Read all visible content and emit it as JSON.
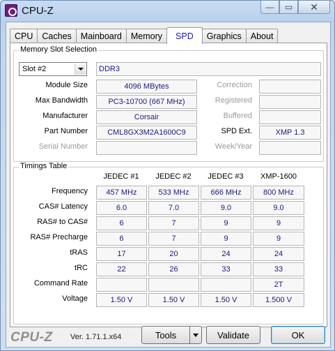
{
  "window": {
    "title": "CPU-Z",
    "caption_buttons": {
      "minimize": "—",
      "maximize": "▭",
      "close": "✕"
    }
  },
  "tabs": [
    "CPU",
    "Caches",
    "Mainboard",
    "Memory",
    "SPD",
    "Graphics",
    "About"
  ],
  "active_tab": "SPD",
  "memory_slot_selection": {
    "title": "Memory Slot Selection",
    "slot": "Slot #2",
    "type": "DDR3",
    "module_size_label": "Module Size",
    "module_size": "4096 MBytes",
    "max_bandwidth_label": "Max Bandwidth",
    "max_bandwidth": "PC3-10700 (667 MHz)",
    "manufacturer_label": "Manufacturer",
    "manufacturer": "Corsair",
    "part_number_label": "Part Number",
    "part_number": "CML8GX3M2A1600C9",
    "serial_number_label": "Serial Number",
    "serial_number": "",
    "correction_label": "Correction",
    "correction": "",
    "registered_label": "Registered",
    "registered": "",
    "buffered_label": "Buffered",
    "buffered": "",
    "spd_ext_label": "SPD Ext.",
    "spd_ext": "XMP 1.3",
    "week_year_label": "Week/Year",
    "week_year": ""
  },
  "timings_table": {
    "title": "Timings Table",
    "columns": [
      "JEDEC #1",
      "JEDEC #2",
      "JEDEC #3",
      "XMP-1600"
    ],
    "rows": [
      {
        "label": "Frequency",
        "values": [
          "457 MHz",
          "533 MHz",
          "666 MHz",
          "800 MHz"
        ]
      },
      {
        "label": "CAS# Latency",
        "values": [
          "6.0",
          "7.0",
          "9.0",
          "9.0"
        ]
      },
      {
        "label": "RAS# to CAS#",
        "values": [
          "6",
          "7",
          "9",
          "9"
        ]
      },
      {
        "label": "RAS# Precharge",
        "values": [
          "6",
          "7",
          "9",
          "9"
        ]
      },
      {
        "label": "tRAS",
        "values": [
          "17",
          "20",
          "24",
          "24"
        ]
      },
      {
        "label": "tRC",
        "values": [
          "22",
          "26",
          "33",
          "33"
        ]
      },
      {
        "label": "Command Rate",
        "values": [
          "",
          "",
          "",
          "2T"
        ]
      },
      {
        "label": "Voltage",
        "values": [
          "1.50 V",
          "1.50 V",
          "1.50 V",
          "1.500 V"
        ]
      }
    ]
  },
  "footer": {
    "logo": "CPU-Z",
    "version": "Ver. 1.71.1.x64",
    "tools": "Tools",
    "validate": "Validate",
    "ok": "OK"
  }
}
